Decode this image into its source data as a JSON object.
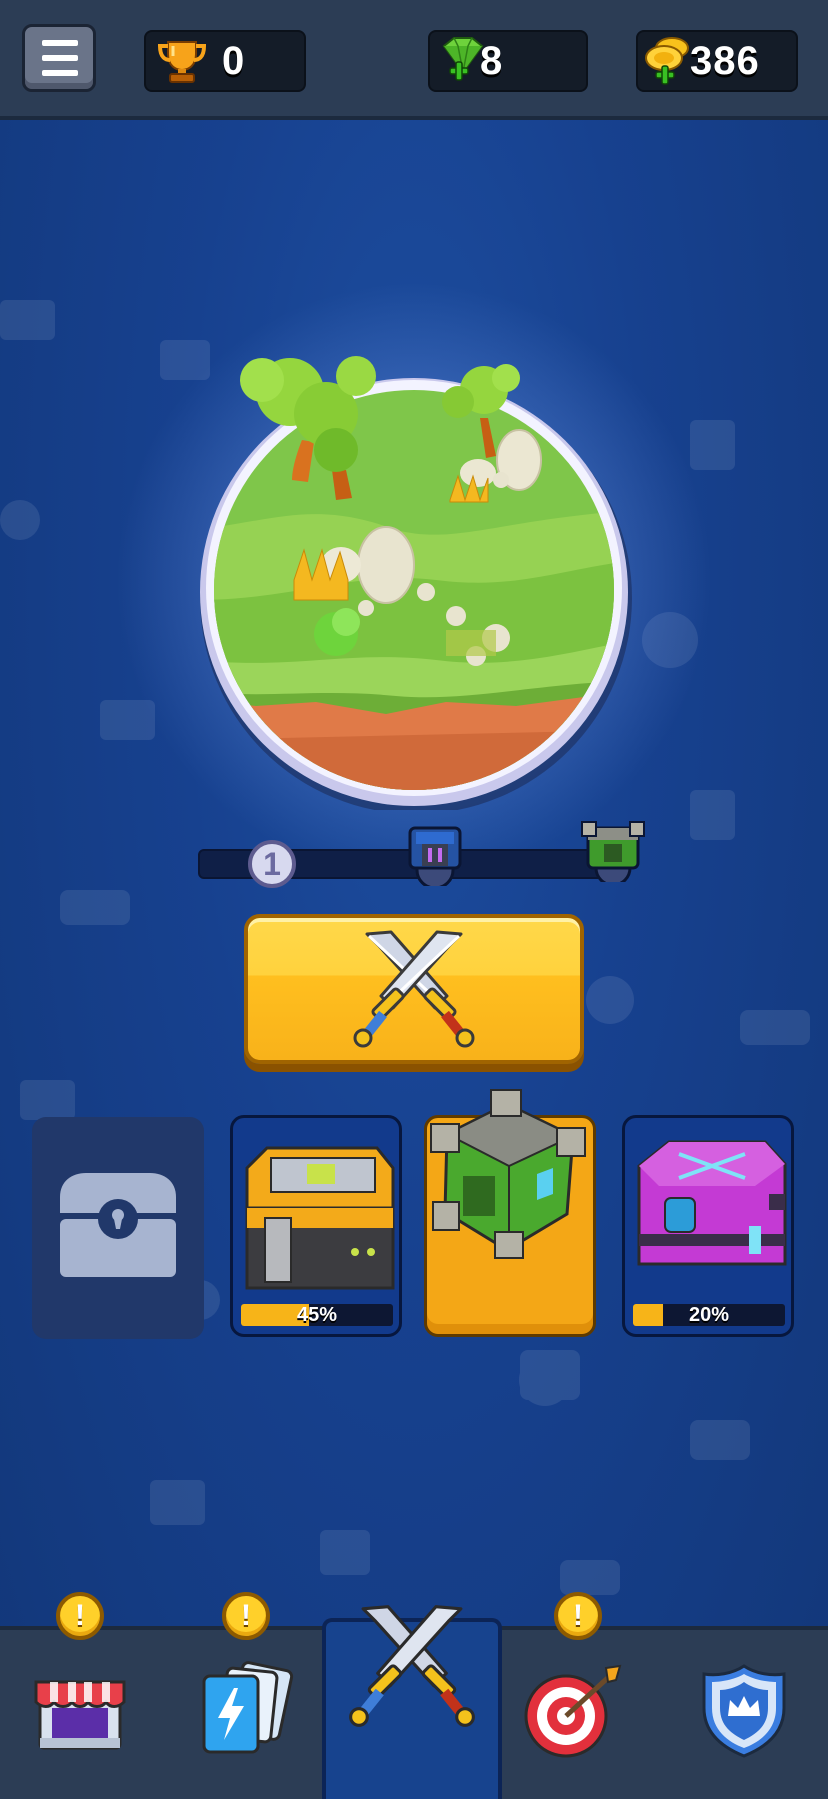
{
  "topbar": {
    "menu_icon": "hamburger-menu-icon",
    "trophies": {
      "icon": "trophy-icon",
      "value": "0"
    },
    "gems": {
      "icon": "green-gem-plus-icon",
      "value": "8"
    },
    "coins": {
      "icon": "gold-coin-plus-icon",
      "value": "386"
    }
  },
  "world": {
    "image": "grass-island-world",
    "level": "1",
    "reward_chests": [
      "blue-tech-chest-icon",
      "green-metal-chest-icon"
    ]
  },
  "battle_button": {
    "icon": "crossed-swords-icon"
  },
  "chest_slots": [
    {
      "type": "empty",
      "icon": "locked-chest-slot-icon"
    },
    {
      "type": "yellow-chest",
      "progress": 45,
      "progress_label": "45%"
    },
    {
      "type": "green-chest",
      "ready": true
    },
    {
      "type": "purple-chest",
      "progress": 20,
      "progress_label": "20%"
    }
  ],
  "bottom_nav": [
    {
      "id": "shop",
      "icon": "shop-store-icon",
      "alert": "!"
    },
    {
      "id": "cards",
      "icon": "cards-icon",
      "alert": "!"
    },
    {
      "id": "battle",
      "icon": "crossed-swords-icon",
      "active": true
    },
    {
      "id": "missions",
      "icon": "target-dart-icon",
      "alert": "!"
    },
    {
      "id": "clan",
      "icon": "shield-crown-icon"
    }
  ],
  "colors": {
    "background": "#143a86",
    "topbar": "#2c3d55",
    "accent_yellow": "#ffd23d",
    "progress_fill": "#f7b418"
  }
}
